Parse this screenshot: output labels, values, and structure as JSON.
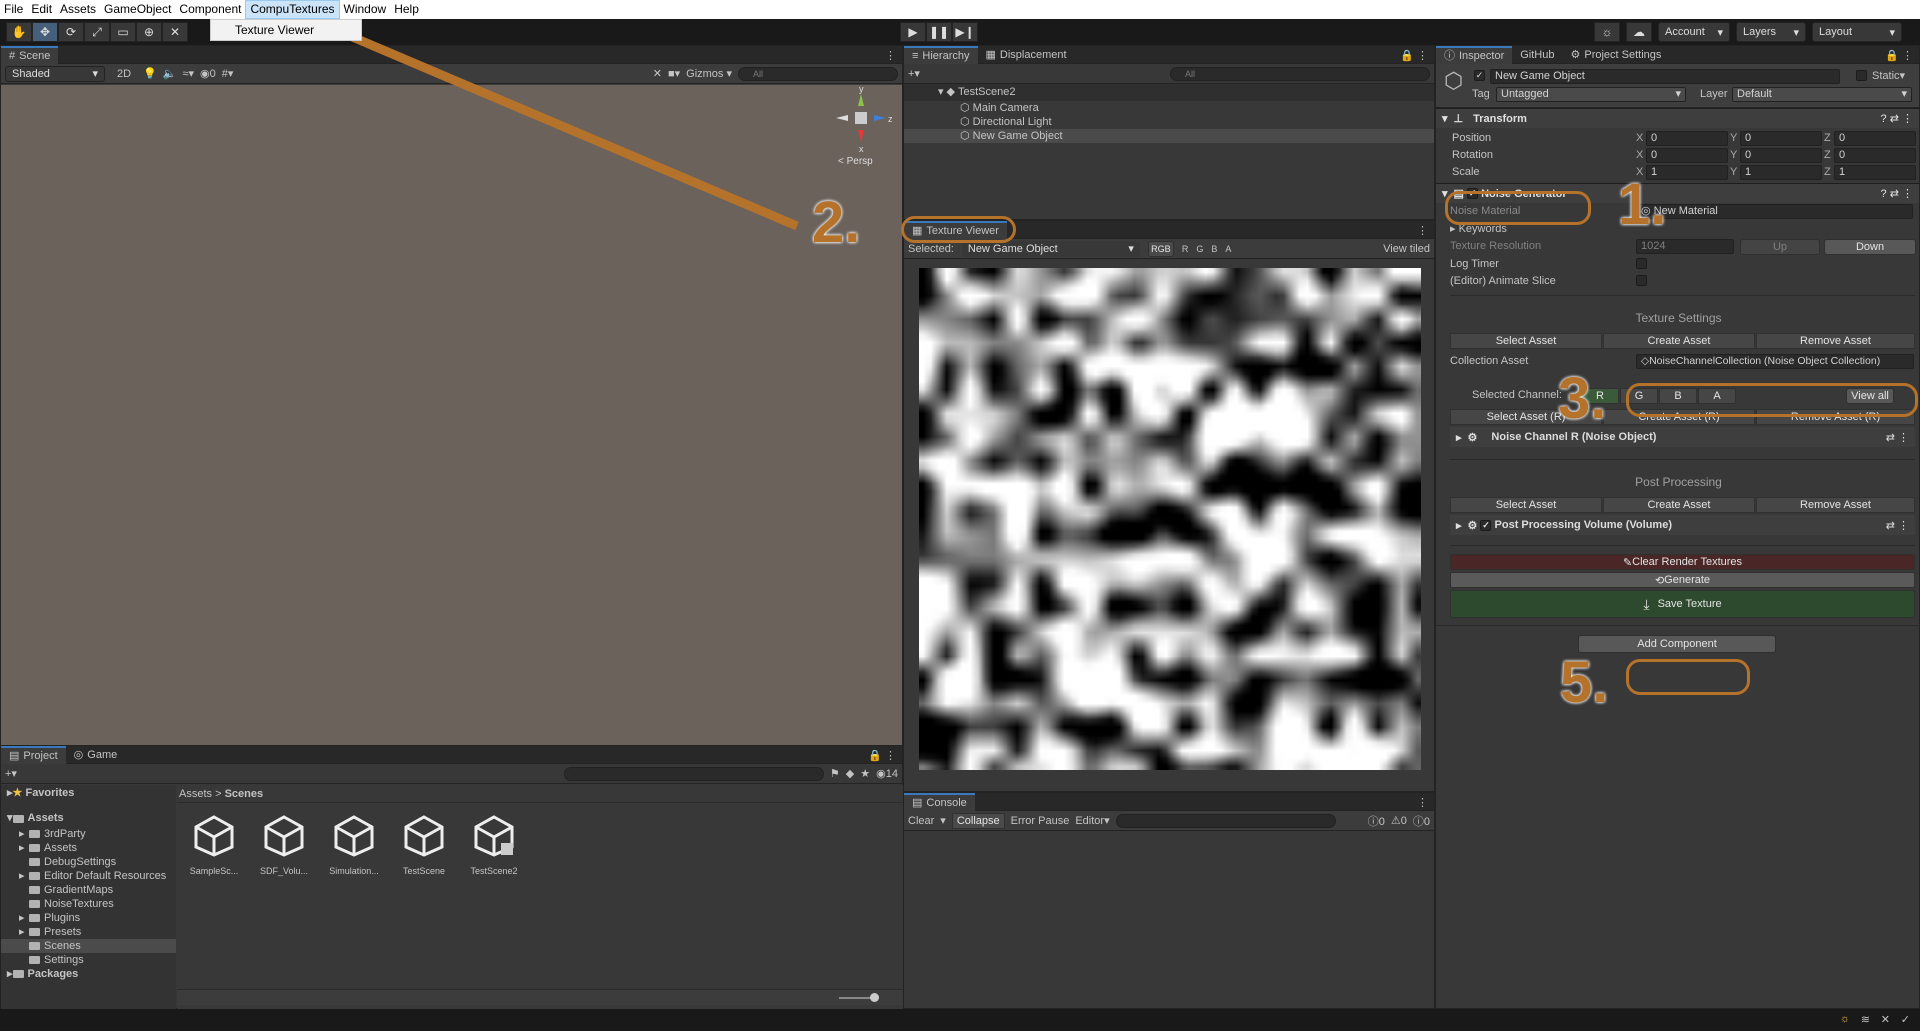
{
  "menubar": {
    "items": [
      "File",
      "Edit",
      "Assets",
      "GameObject",
      "Component",
      "CompuTextures",
      "Window",
      "Help"
    ],
    "open_submenu_item": "Texture Viewer"
  },
  "toolbar": {
    "account": "Account",
    "layers": "Layers",
    "layout": "Layout"
  },
  "scene": {
    "tab": "Scene",
    "shading": "Shaded",
    "mode2d": "2D",
    "hidden_count": "0",
    "gizmos": "Gizmos",
    "search_placeholder": "All",
    "persp": "< Persp",
    "axis_y": "y",
    "axis_x": "x",
    "axis_z": "z"
  },
  "hierarchy": {
    "tab": "Hierarchy",
    "tab2": "Displacement",
    "search_placeholder": "All",
    "scene": "TestScene2",
    "items": [
      "Main Camera",
      "Directional Light",
      "New Game Object"
    ]
  },
  "texture_viewer": {
    "tab": "Texture Viewer",
    "selected_label": "Selected:",
    "selected_value": "New Game Object",
    "channels": [
      "RGB",
      "R",
      "G",
      "B",
      "A"
    ],
    "view_tiled": "View tiled"
  },
  "inspector": {
    "tabs": [
      "Inspector",
      "GitHub",
      "Project Settings"
    ],
    "object_name": "New Game Object",
    "static": "Static",
    "tag_label": "Tag",
    "tag": "Untagged",
    "layer_label": "Layer",
    "layer": "Default",
    "transform": {
      "title": "Transform",
      "rows": [
        {
          "label": "Position",
          "x": "0",
          "y": "0",
          "z": "0"
        },
        {
          "label": "Rotation",
          "x": "0",
          "y": "0",
          "z": "0"
        },
        {
          "label": "Scale",
          "x": "1",
          "y": "1",
          "z": "1"
        }
      ]
    },
    "noise": {
      "title": "Noise Generator",
      "noise_material_label": "Noise Material",
      "noise_material": "New Material",
      "keywords": "Keywords",
      "tex_res_label": "Texture Resolution",
      "tex_res": "1024",
      "up": "Up",
      "down": "Down",
      "log_timer": "Log Timer",
      "animate_slice": "(Editor) Animate Slice",
      "texture_settings": "Texture Settings",
      "select_asset": "Select Asset",
      "create_asset": "Create Asset",
      "remove_asset": "Remove Asset",
      "collection_label": "Collection Asset",
      "collection_value": "NoiseChannelCollection (Noise Object Collection)",
      "selected_channel": "Selected Channel:",
      "channels": [
        "R",
        "G",
        "B",
        "A"
      ],
      "view_all": "View all",
      "select_asset_r": "Select Asset (R)",
      "create_asset_r": "Create Asset (R)",
      "remove_asset_r": "Remove Asset (R)",
      "noise_channel": "Noise Channel R (Noise Object)",
      "post_processing": "Post Processing",
      "pp_volume": "Post Processing Volume (Volume)",
      "clear_rt": "Clear Render Textures",
      "generate": "Generate",
      "save_texture": "Save Texture"
    },
    "add_component": "Add Component"
  },
  "project": {
    "tab": "Project",
    "tab2": "Game",
    "count": "14",
    "favorites": "Favorites",
    "assets": "Assets",
    "folders": [
      "3rdParty",
      "Assets",
      "DebugSettings",
      "Editor Default Resources",
      "GradientMaps",
      "NoiseTextures",
      "Plugins",
      "Presets",
      "Scenes",
      "Settings"
    ],
    "packages": "Packages",
    "breadcrumb": [
      "Assets",
      "Scenes"
    ],
    "files": [
      "SampleSc...",
      "SDF_Volu...",
      "Simulation...",
      "TestScene",
      "TestScene2"
    ]
  },
  "console": {
    "tab": "Console",
    "clear": "Clear",
    "collapse": "Collapse",
    "error_pause": "Error Pause",
    "editor": "Editor",
    "log": "0",
    "warn": "0",
    "err": "0"
  },
  "annotations": [
    "1.",
    "2.",
    "3.",
    "5."
  ],
  "colors": {
    "accent": "#b5722a",
    "save_bg": "#2e4a2e",
    "clear_bg": "#4a2626",
    "selected_channel": "#3a5a3a"
  }
}
